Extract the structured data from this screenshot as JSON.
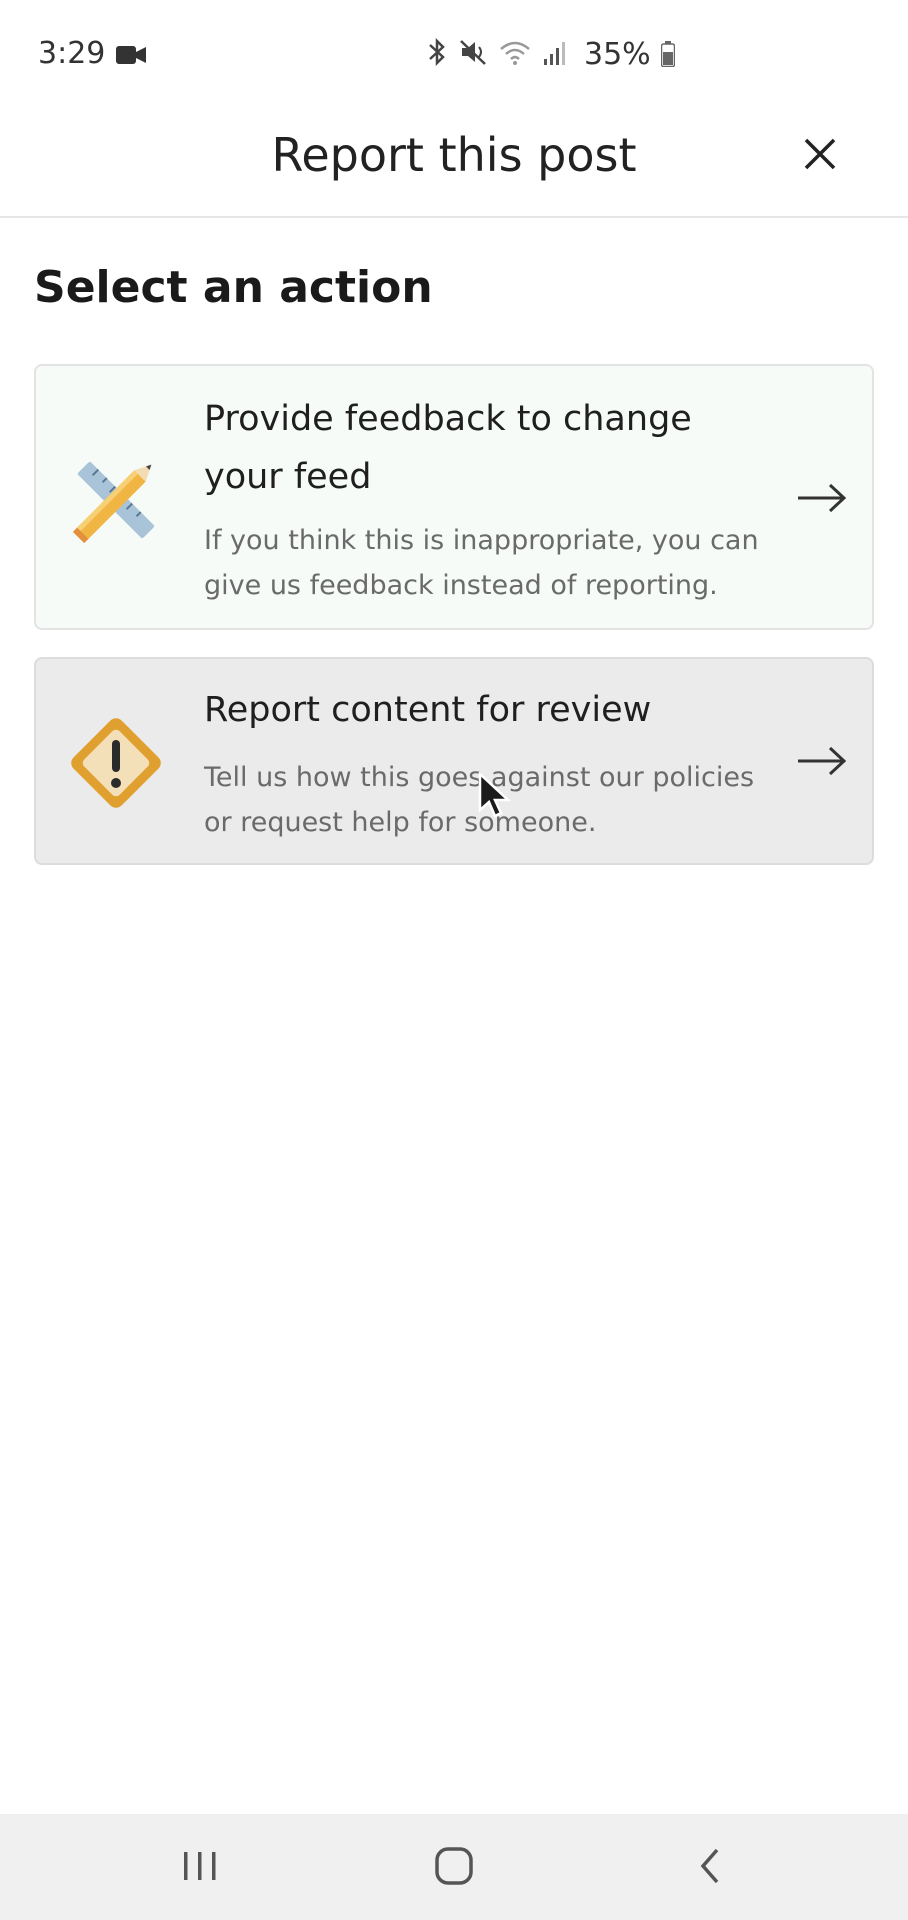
{
  "status_bar": {
    "time": "3:29",
    "battery": "35%"
  },
  "header": {
    "title": "Report this post"
  },
  "main": {
    "section_title": "Select an action",
    "options": [
      {
        "title": "Provide feedback to change your feed",
        "description": "If you think this is inappropriate, you can give us feedback instead of reporting.",
        "icon": "pencil-ruler-icon"
      },
      {
        "title": "Report content for review",
        "description": "Tell us how this goes against our policies or request help for someone.",
        "icon": "warning-diamond-icon"
      }
    ]
  },
  "colors": {
    "feedback_card_bg": "#f7fbf8",
    "report_card_bg": "#ebebeb",
    "warning_orange": "#e0a030",
    "warning_fill": "#f3dfb8"
  }
}
